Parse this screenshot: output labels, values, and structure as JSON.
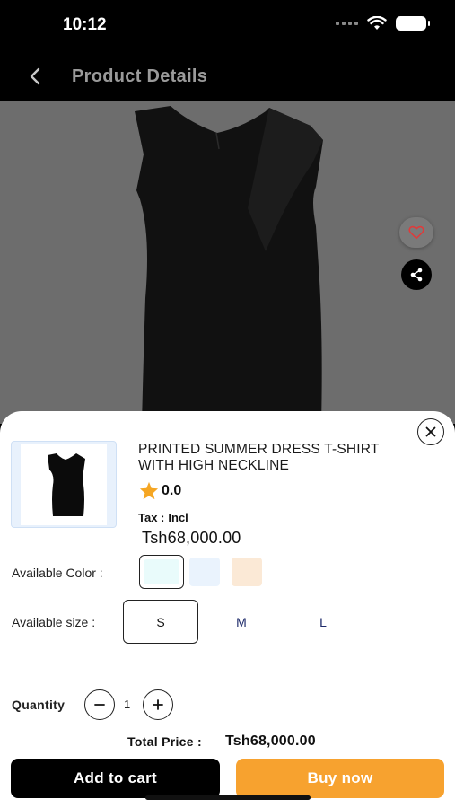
{
  "status_bar": {
    "time": "10:12"
  },
  "nav": {
    "title": "Product Details"
  },
  "product": {
    "title": "PRINTED SUMMER DRESS T-SHIRT WITH HIGH NECKLINE",
    "rating": "0.0",
    "tax_label": "Tax :",
    "tax_value": "Incl",
    "price": "Tsh68,000.00"
  },
  "options": {
    "color_label": "Available Color :",
    "colors": [
      "#e9fbfb",
      "#eaf3fd",
      "#fbe9d6"
    ],
    "selected_color_index": 0,
    "size_label": "Available  size :",
    "sizes": [
      "S",
      "M",
      "L"
    ],
    "selected_size_index": 0
  },
  "quantity": {
    "label": "Quantity",
    "value": "1"
  },
  "total": {
    "label": "Total Price :",
    "value": "Tsh68,000.00"
  },
  "actions": {
    "add_to_cart": "Add to cart",
    "buy_now": "Buy now"
  },
  "colors": {
    "accent_orange": "#f7a22f",
    "hero_bg": "#6d6d6d",
    "star": "#f5a623"
  },
  "icons": [
    "back-chevron-icon",
    "heart-icon",
    "share-icon",
    "close-icon",
    "star-icon",
    "minus-icon",
    "plus-icon",
    "wifi-icon",
    "battery-icon"
  ]
}
